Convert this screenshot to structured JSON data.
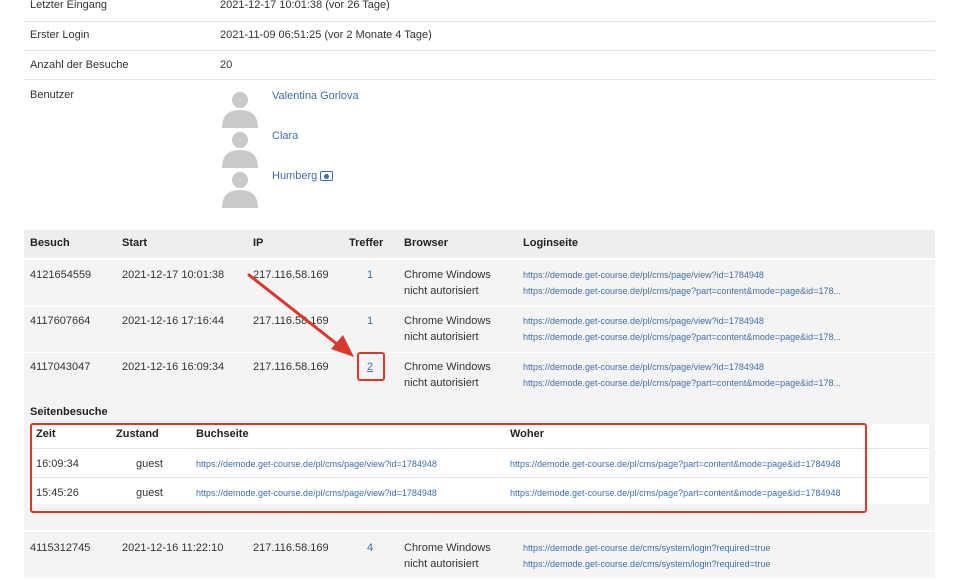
{
  "info": [
    {
      "label": "Letzter Eingang",
      "value": "2021-12-17 10:01:38 (vor 26 Tage)"
    },
    {
      "label": "Erster Login",
      "value": "2021-11-09 06:51:25 (vor 2 Monate 4 Tage)"
    },
    {
      "label": "Anzahl der Besuche",
      "value": "20"
    },
    {
      "label": "Benutzer",
      "value": ""
    }
  ],
  "users": [
    "Valentina Gorlova",
    "Clara",
    "Humberg"
  ],
  "visits_header": {
    "visit": "Besuch",
    "start": "Start",
    "ip": "IP",
    "hits": "Treffer",
    "browser": "Browser",
    "login": "Loginseite"
  },
  "visits": [
    {
      "id": "4121654559",
      "start": "2021-12-17 10:01:38",
      "ip": "217.116.58.169",
      "hits": "1",
      "browser": "Chrome Windows",
      "auth": "nicht autorisiert",
      "link1": "https://demode.get-course.de/pl/cms/page/view?id=1784948",
      "link2": "https://demode.get-course.de/pl/cms/page?part=content&mode=page&id=178..."
    },
    {
      "id": "4117607664",
      "start": "2021-12-16 17:16:44",
      "ip": "217.116.58.169",
      "hits": "1",
      "browser": "Chrome Windows",
      "auth": "nicht autorisiert",
      "link1": "https://demode.get-course.de/pl/cms/page/view?id=1784948",
      "link2": "https://demode.get-course.de/pl/cms/page?part=content&mode=page&id=178..."
    },
    {
      "id": "4117043047",
      "start": "2021-12-16 16:09:34",
      "ip": "217.116.58.169",
      "hits": "2",
      "browser": "Chrome Windows",
      "auth": "nicht autorisiert",
      "link1": "https://demode.get-course.de/pl/cms/page/view?id=1784948",
      "link2": "https://demode.get-course.de/pl/cms/page?part=content&mode=page&id=178..."
    },
    {
      "id": "4115312745",
      "start": "2021-12-16 11:22:10",
      "ip": "217.116.58.169",
      "hits": "4",
      "browser": "Chrome Windows",
      "auth": "nicht autorisiert",
      "link1": "https://demode.get-course.de/cms/system/login?required=true",
      "link2": "https://demode.get-course.de/cms/system/login?required=true"
    }
  ],
  "page_visits": {
    "title": "Seitenbesuche",
    "header": {
      "time": "Zeit",
      "state": "Zustand",
      "page": "Buchseite",
      "from": "Woher"
    },
    "rows": [
      {
        "time": "16:09:34",
        "state": "guest",
        "page": "https://demode.get-course.de/pl/cms/page/view?id=1784948",
        "from": "https://demode.get-course.de/pl/cms/page?part=content&mode=page&id=1784948"
      },
      {
        "time": "15:45:26",
        "state": "guest",
        "page": "https://demode.get-course.de/pl/cms/page/view?id=1784948",
        "from": "https://demode.get-course.de/pl/cms/page?part=content&mode=page&id=1784948"
      }
    ]
  },
  "colors": {
    "link": "#3f6fa8",
    "highlight": "#d9382d",
    "row_bg": "#f4f4f4"
  }
}
